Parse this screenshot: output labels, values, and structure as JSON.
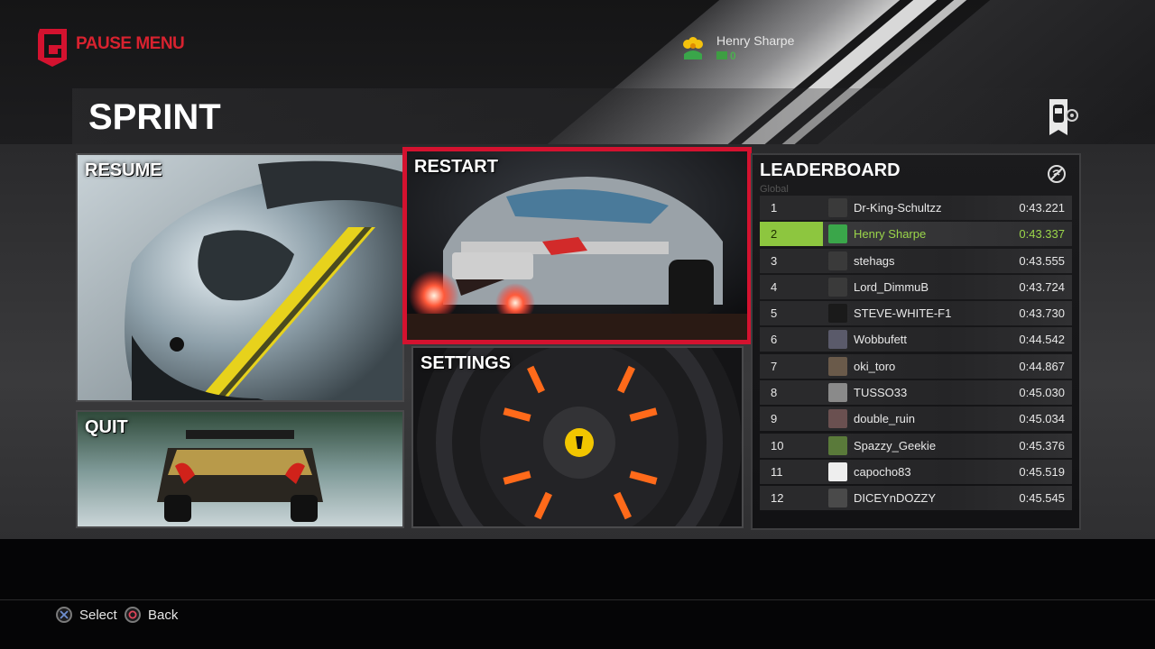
{
  "header": {
    "menu_title": "PAUSE MENU",
    "user": {
      "name": "Henry Sharpe",
      "score": "0"
    }
  },
  "event": {
    "title": "SPRINT"
  },
  "tiles": {
    "resume": "RESUME",
    "restart": "RESTART",
    "settings": "SETTINGS",
    "quit": "QUIT"
  },
  "leaderboard": {
    "title": "LEADERBOARD",
    "subtitle": "Global",
    "rows": [
      {
        "rank": "1",
        "name": "Dr-King-Schultzz",
        "time": "0:43.221"
      },
      {
        "rank": "2",
        "name": "Henry Sharpe",
        "time": "0:43.337"
      },
      {
        "rank": "3",
        "name": "stehags",
        "time": "0:43.555"
      },
      {
        "rank": "4",
        "name": "Lord_DimmuB",
        "time": "0:43.724"
      },
      {
        "rank": "5",
        "name": "STEVE-WHITE-F1",
        "time": "0:43.730"
      },
      {
        "rank": "6",
        "name": "Wobbufett",
        "time": "0:44.542"
      },
      {
        "rank": "7",
        "name": "oki_toro",
        "time": "0:44.867"
      },
      {
        "rank": "8",
        "name": "TUSSO33",
        "time": "0:45.030"
      },
      {
        "rank": "9",
        "name": "double_ruin",
        "time": "0:45.034"
      },
      {
        "rank": "10",
        "name": "Spazzy_Geekie",
        "time": "0:45.376"
      },
      {
        "rank": "11",
        "name": "capocho83",
        "time": "0:45.519"
      },
      {
        "rank": "12",
        "name": "DICEYnDOZZY",
        "time": "0:45.545"
      }
    ]
  },
  "footer": {
    "select": "Select",
    "back": "Back"
  },
  "colors": {
    "accent": "#d4122f",
    "highlight": "#8dc63f",
    "score": "#4caf50"
  },
  "icons": [
    "driveclub-logo-icon",
    "flower-avatar-icon",
    "event-badge-icon",
    "offline-icon",
    "cross-button-icon",
    "circle-button-icon"
  ]
}
